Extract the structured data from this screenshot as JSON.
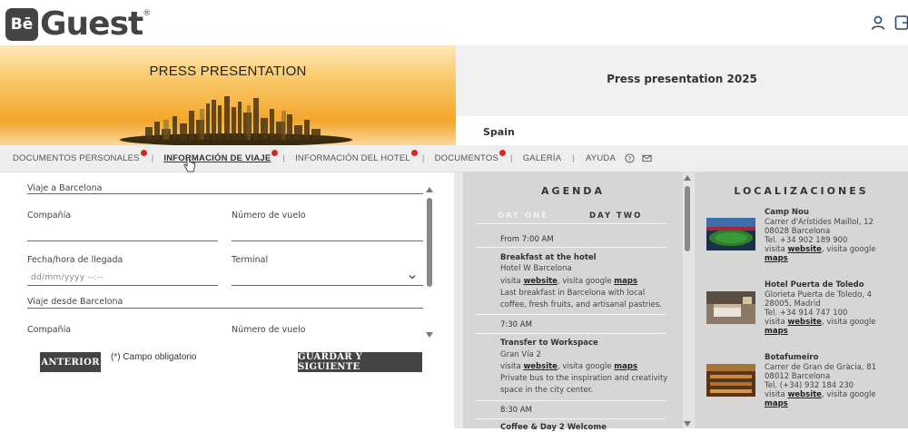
{
  "header": {
    "logo_mark": "Bē",
    "logo_text": "Guest",
    "logo_reg": "®",
    "user_icon": "user-icon",
    "logout_icon": "logout-icon"
  },
  "banner": {
    "title": "PRESS PRESENTATION",
    "colors": {
      "gold_top": "#fde8b8",
      "gold_mid": "#f3a62b",
      "skyline": "#3a2a10"
    }
  },
  "event": {
    "title": "Press presentation 2025",
    "country": "Spain"
  },
  "tabs": [
    {
      "label": "DOCUMENTOS PERSONALES",
      "badge": true,
      "active": false
    },
    {
      "label": "INFORMACIÓN DE VIAJE",
      "badge": true,
      "active": true
    },
    {
      "label": "INFORMACIÓN DEL HOTEL",
      "badge": true,
      "active": false
    },
    {
      "label": "DOCUMENTOS",
      "badge": true,
      "active": false
    },
    {
      "label": "GALERÍA",
      "badge": false,
      "active": false
    },
    {
      "label": "AYUDA",
      "badge": false,
      "active": false
    }
  ],
  "tab_icons": {
    "help": "help-circle-icon",
    "mail": "mail-icon"
  },
  "form": {
    "section_arrival": "Viaje a Barcelona",
    "company_label": "Compañía",
    "flight_label": "Número de vuelo",
    "arrival_datetime_label": "Fecha/hora de llegada",
    "terminal_label": "Terminal",
    "date_placeholder": "dd/mm/yyyy --:--",
    "section_departure": "Viaje desde Barcelona",
    "company_label_2": "Compañía",
    "flight_label_2": "Número de vuelo",
    "prev_button": "ANTERIOR",
    "required_note": "(*) Campo obligatorio",
    "save_next_button": "GUARDAR Y SIGUIENTE"
  },
  "agenda": {
    "title": "AGENDA",
    "day_one": "DAY ONE",
    "day_two": "DAY TWO",
    "items": [
      {
        "time": "From 7:00 AM",
        "title": "Breakfast at the hotel",
        "place": "Hotel W Barcelona",
        "links_prefix": "visita ",
        "link1": "website",
        "links_mid": ", visita google ",
        "link2": "maps",
        "desc1": "Last breakfast in Barcelona with local",
        "desc2": "coffee, fresh fruits, and artisanal pastries."
      },
      {
        "time": "7:30 AM",
        "title": "Transfer to Workspace",
        "place": "Gran Vía 2",
        "links_prefix": "visita ",
        "link1": "website",
        "links_mid": ", visita google ",
        "link2": "maps",
        "desc1": "Private bus to the inspiration and creativity",
        "desc2": "space in the city center."
      },
      {
        "time": "8:30 AM",
        "title": "Coffee & Day 2 Welcome"
      }
    ]
  },
  "locations": {
    "title": "LOCALIZACIONES",
    "items": [
      {
        "name": "Camp Nou",
        "addr1": "Carrer d'Arístides Maillol, 12",
        "addr2": "08028 Barcelona",
        "tel": "Tel. +34 902 189 900",
        "links_prefix": "visita ",
        "link1": "website",
        "links_mid": ", visita google",
        "link2": "maps"
      },
      {
        "name": "Hotel Puerta de Toledo",
        "addr1": "Glorieta Puerta de Toledo, 4",
        "addr2": "28005, Madrid",
        "tel": "Tel. +34 914 747 100",
        "links_prefix": "visita ",
        "link1": "website",
        "links_mid": ", visita google",
        "link2": "maps"
      },
      {
        "name": "Botafumeiro",
        "addr1": "Carrer de Gran de Gràcia, 81",
        "addr2": "08012 Barcelona",
        "tel": "Tel. (+34) 932 184 230",
        "links_prefix": "visita ",
        "link1": "website",
        "links_mid": ", visita google",
        "link2": "maps"
      }
    ]
  }
}
